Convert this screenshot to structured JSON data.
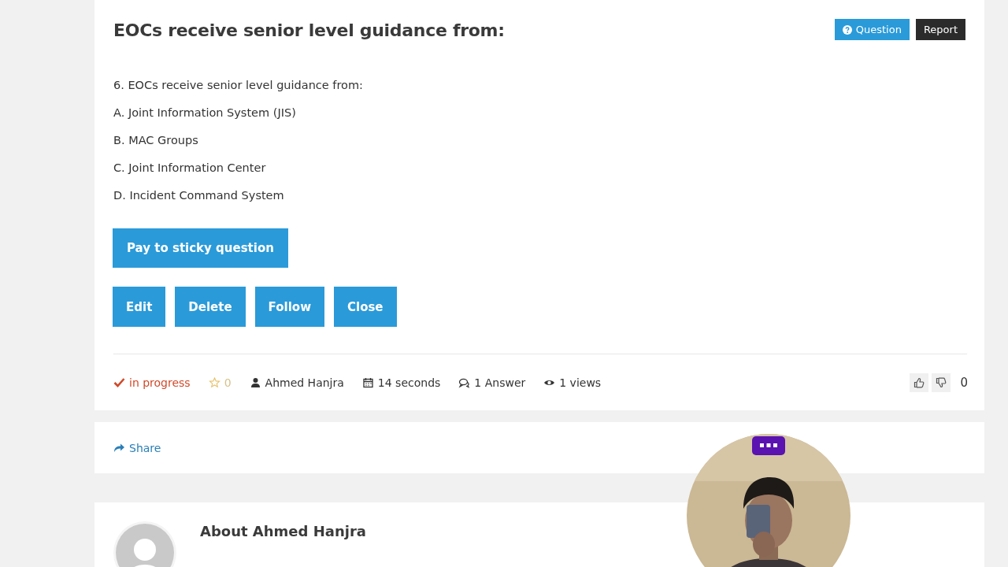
{
  "question": {
    "title": "EOCs receive senior level guidance from:",
    "tags": [
      {
        "kind": "question",
        "label": "Question"
      },
      {
        "kind": "report",
        "label": "Report"
      }
    ],
    "body": [
      "6. EOCs receive senior level guidance from:",
      "A. Joint Information System (JIS)",
      "B. MAC Groups",
      "C. Joint Information Center",
      "D. Incident Command System"
    ],
    "sticky_button": "Pay to sticky question",
    "actions": [
      "Edit",
      "Delete",
      "Follow",
      "Close"
    ],
    "meta": [
      {
        "kind": "status",
        "text": "in progress"
      },
      {
        "kind": "favorites",
        "text": "0"
      },
      {
        "kind": "author",
        "text": "Ahmed Hanjra"
      },
      {
        "kind": "time",
        "text": "14 seconds"
      },
      {
        "kind": "answers",
        "text": "1 Answer"
      },
      {
        "kind": "views",
        "text": "1 views"
      }
    ],
    "votes": "0"
  },
  "share": "Share",
  "about": {
    "title": "About Ahmed Hanjra"
  }
}
